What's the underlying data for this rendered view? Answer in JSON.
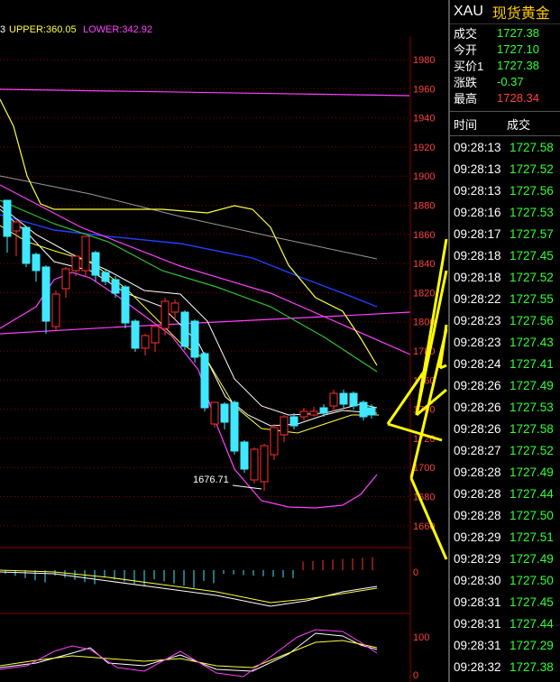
{
  "indicator_header": {
    "prefix": "3",
    "upper": "UPPER:360.05",
    "lower": "LOWER:342.92"
  },
  "price_axis": [
    "1980",
    "1960",
    "1940",
    "1920",
    "1900",
    "1880",
    "1860",
    "1840",
    "1820",
    "1800",
    "1780",
    "1760",
    "1740",
    "1720",
    "1700",
    "1680",
    "1660"
  ],
  "low_annotation": "1676.71",
  "macd_zero_label": "0",
  "kdj_labels": [
    "100",
    "0"
  ],
  "symbol": {
    "code": "XAU",
    "name": "现货黄金"
  },
  "quote": [
    {
      "label": "成交",
      "value": "1727.38",
      "color": "green"
    },
    {
      "label": "今开",
      "value": "1727.10",
      "color": "green"
    },
    {
      "label": "买价1",
      "value": "1727.38",
      "color": "green"
    },
    {
      "label": "涨跌",
      "value": "-0.37",
      "color": "green"
    },
    {
      "label": "最高",
      "value": "1728.34",
      "color": "red"
    }
  ],
  "ticks_header": {
    "time": "时间",
    "price": "成交"
  },
  "ticks": [
    {
      "time": "09:28:13",
      "price": "1727.58"
    },
    {
      "time": "09:28:13",
      "price": "1727.52"
    },
    {
      "time": "09:28:13",
      "price": "1727.56"
    },
    {
      "time": "09:28:16",
      "price": "1727.53"
    },
    {
      "time": "09:28:17",
      "price": "1727.57"
    },
    {
      "time": "09:28:18",
      "price": "1727.45"
    },
    {
      "time": "09:28:18",
      "price": "1727.52"
    },
    {
      "time": "09:28:22",
      "price": "1727.55"
    },
    {
      "time": "09:28:23",
      "price": "1727.56"
    },
    {
      "time": "09:28:23",
      "price": "1727.43"
    },
    {
      "time": "09:28:24",
      "price": "1727.41"
    },
    {
      "time": "09:28:26",
      "price": "1727.49"
    },
    {
      "time": "09:28:26",
      "price": "1727.53"
    },
    {
      "time": "09:28:26",
      "price": "1727.58"
    },
    {
      "time": "09:28:27",
      "price": "1727.52"
    },
    {
      "time": "09:28:28",
      "price": "1727.49"
    },
    {
      "time": "09:28:28",
      "price": "1727.44"
    },
    {
      "time": "09:28:28",
      "price": "1727.50"
    },
    {
      "time": "09:28:29",
      "price": "1727.51"
    },
    {
      "time": "09:28:29",
      "price": "1727.49"
    },
    {
      "time": "09:28:30",
      "price": "1727.50"
    },
    {
      "time": "09:28:31",
      "price": "1727.45"
    },
    {
      "time": "09:28:31",
      "price": "1727.44"
    },
    {
      "time": "09:28:31",
      "price": "1727.29"
    },
    {
      "time": "09:28:32",
      "price": "1727.38"
    }
  ],
  "colors": {
    "up": "#ff3030",
    "down": "#40e8ff",
    "ma_yellow": "#ffff40",
    "ma_white": "#ffffff",
    "ma_green": "#30c030",
    "ma_blue": "#2040ff",
    "ma_magenta": "#ff40ff",
    "grid": "#8b0000",
    "arrow": "#ffff00"
  }
}
